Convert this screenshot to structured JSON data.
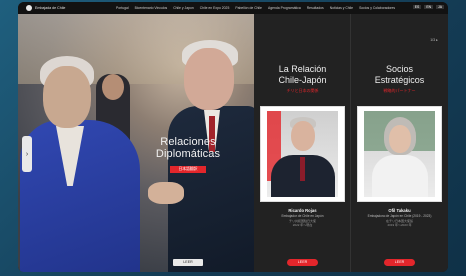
{
  "nav": {
    "logo_text": "Embajada de Chile",
    "items": [
      "Portugal",
      "Bicentenario Vinculos",
      "Chile y Japon",
      "Chile en Expo 2025",
      "Pabellón de Chile",
      "Agenda Programática",
      "Resultados",
      "Noticias y Chile",
      "Socios y Colaboradores"
    ],
    "langs": [
      "ES",
      "EN",
      "JA"
    ]
  },
  "hero": {
    "title_line1": "Relaciones",
    "title_line2": "Diplomáticas",
    "subtitle_button": "日本語翻訳",
    "cta": "LEER"
  },
  "counter": "1/3 ▸",
  "columns": [
    {
      "heading_line1": "La Relación",
      "heading_line2": "Chile-Japón",
      "subheading": "チリと日本の関係",
      "name": "Ricardo Rojas",
      "role": "Embajador de Chile en Japón",
      "role_ja": "チリ共和国駐日大使",
      "role_ja2": "2022 年～現在",
      "cta": "LEER"
    },
    {
      "heading_line1": "Socios",
      "heading_line2": "Estratégicos",
      "subheading": "戦略的パートナー",
      "name": "Ofil Takaku",
      "role": "Embajadora de Japón en Chile (2019 - 2023)",
      "role_ja": "在チリ日本国大使館",
      "role_ja2": "2019 年～2023 年",
      "cta": "LEER"
    }
  ]
}
